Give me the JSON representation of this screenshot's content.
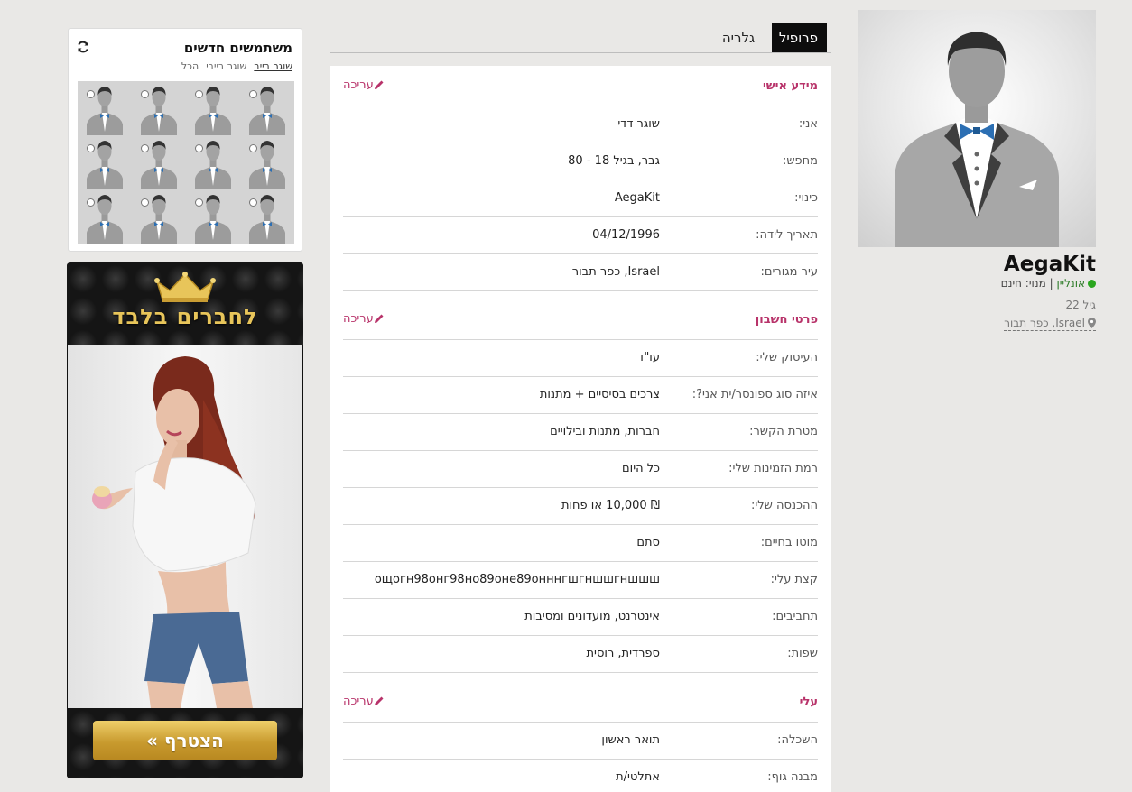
{
  "profile": {
    "username": "AegaKit",
    "status": "אונליין",
    "separator": "|",
    "subscription": "מנוי: חינם",
    "age": "גיל 22",
    "location": "Israel, כפר תבור"
  },
  "tabs": [
    {
      "label": "פרופיל",
      "active": true
    },
    {
      "label": "גלריה",
      "active": false
    }
  ],
  "sections": {
    "personal": {
      "title": "מידע אישי",
      "edit_label": "עריכה",
      "rows": [
        {
          "label": "אני:",
          "value": "שוגר דדי"
        },
        {
          "label": "מחפש:",
          "value": "גבר, בגיל 18 - 80"
        },
        {
          "label": "כינוי:",
          "value": "AegaKit"
        },
        {
          "label": "תאריך לידה:",
          "value": "04/12/1996"
        },
        {
          "label": "עיר מגורים:",
          "value": "Israel, כפר תבור"
        }
      ]
    },
    "account": {
      "title": "פרטי חשבון",
      "edit_label": "עריכה",
      "rows": [
        {
          "label": "העיסוק שלי:",
          "value": "עו\"ד"
        },
        {
          "label": "איזה סוג ספונסר/ית אני?:",
          "value": "צרכים בסיסיים + מתנות"
        },
        {
          "label": "מטרת הקשר:",
          "value": "חברות, מתנות ובילויים"
        },
        {
          "label": "רמת הזמינות שלי:",
          "value": "כל היום"
        },
        {
          "label": "ההכנסה שלי:",
          "value": "₪ 10,000 או פחות"
        },
        {
          "label": "מוטו בחיים:",
          "value": "סתם"
        },
        {
          "label": "קצת עלי:",
          "value": "ощогн98онг98но89оне89онннгшгншшгншшш"
        },
        {
          "label": "תחביבים:",
          "value": "אינטרנט, מועדונים ומסיבות"
        },
        {
          "label": "שפות:",
          "value": "ספרדית, רוסית"
        }
      ]
    },
    "about": {
      "title": "עלי",
      "edit_label": "עריכה",
      "rows": [
        {
          "label": "השכלה:",
          "value": "תואר ראשון"
        },
        {
          "label": "מבנה גוף:",
          "value": "אתלטי/ת"
        }
      ]
    }
  },
  "new_users": {
    "title": "משתמשים חדשים",
    "filters": [
      "שוגר בייב",
      "שוגר בייבי",
      "הכל"
    ],
    "active_filter": "שוגר בייב",
    "thumb_count": 12
  },
  "promo": {
    "title": "לחברים בלבד",
    "button_label": "הצטרף »"
  },
  "colors": {
    "accent": "#b8336a",
    "online": "#2aa61f",
    "gold": "#e8c55a",
    "background": "#e9e8e6"
  },
  "icons": {
    "edit": "pencil-icon",
    "refresh": "refresh-icon",
    "location": "map-pin-icon",
    "online": "online-dot-icon",
    "crown": "crown-icon"
  }
}
